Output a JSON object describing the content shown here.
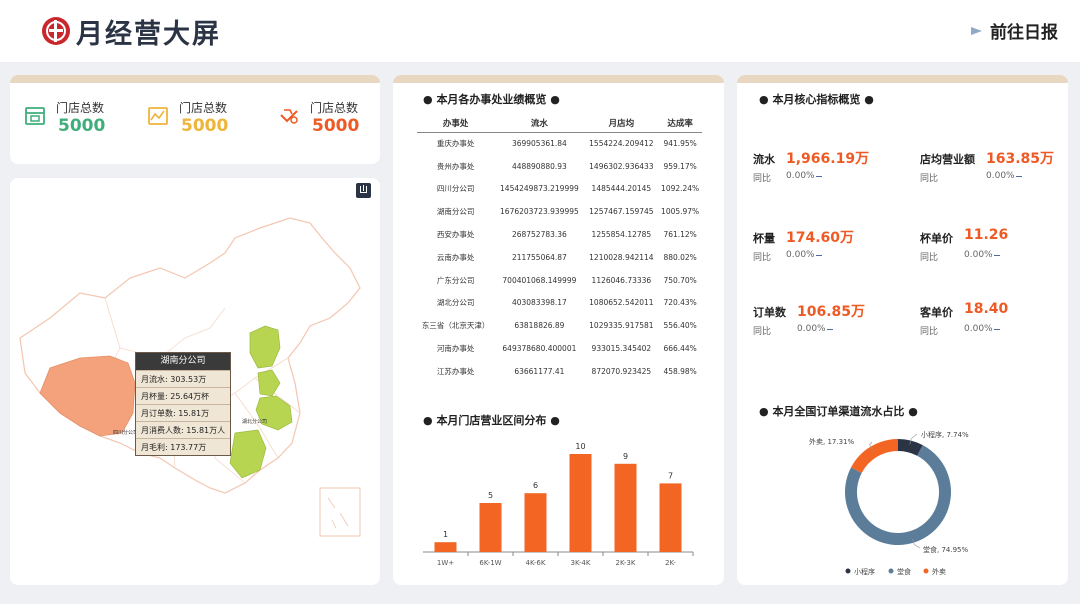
{
  "header": {
    "title": "月经营大屏",
    "goto_label": "前往日报"
  },
  "store_totals": [
    {
      "label": "门店总数",
      "value": "5000",
      "color": "#3fae7a",
      "icon": "store-icon"
    },
    {
      "label": "门店总数",
      "value": "5000",
      "color": "#efb43a",
      "icon": "chart-icon"
    },
    {
      "label": "门店总数",
      "value": "5000",
      "color": "#ef5a24",
      "icon": "hand-icon"
    }
  ],
  "map": {
    "tooltip": {
      "title": "湖南分公司",
      "rows": [
        "月流水: 303.53万",
        "月杯量: 25.64万杯",
        "月订单数: 15.81万",
        "月消费人数: 15.81万人",
        "月毛利: 173.77万"
      ]
    },
    "labels": {
      "sichuan": "四川分公司",
      "hubei": "湖北分公司"
    },
    "colors": {
      "highlight": "#f3a27c",
      "green": "#b8d552",
      "base": "#ffffff",
      "border": "#f3c6b0"
    }
  },
  "office_section": {
    "title": "本月各办事处业绩概览",
    "headers": [
      "办事处",
      "流水",
      "月店均",
      "达成率"
    ],
    "rows": [
      [
        "重庆办事处",
        "369905361.84",
        "1554224.209412",
        "941.95%"
      ],
      [
        "贵州办事处",
        "448890880.93",
        "1496302.936433",
        "959.17%"
      ],
      [
        "四川分公司",
        "1454249873.219999",
        "1485444.20145",
        "1092.24%"
      ],
      [
        "湖南分公司",
        "1676203723.939995",
        "1257467.159745",
        "1005.97%"
      ],
      [
        "西安办事处",
        "268752783.36",
        "1255854.12785",
        "761.12%"
      ],
      [
        "云南办事处",
        "211755064.87",
        "1210028.942114",
        "880.02%"
      ],
      [
        "广东分公司",
        "700401068.149999",
        "1126046.73336",
        "750.70%"
      ],
      [
        "湖北分公司",
        "403083398.17",
        "1080652.542011",
        "720.43%"
      ],
      [
        "东三省（北京天津）",
        "63818826.89",
        "1029335.917581",
        "556.40%"
      ],
      [
        "河南办事处",
        "649378680.400001",
        "933015.345402",
        "666.44%"
      ],
      [
        "江苏办事处",
        "63661177.41",
        "872070.923425",
        "458.98%"
      ]
    ]
  },
  "range_section": {
    "title": "本月门店营业区间分布"
  },
  "kpi_section": {
    "title": "本月核心指标概览",
    "items": [
      {
        "name": "流水",
        "value": "1,966.19万",
        "yoy_label": "同比",
        "yoy": "0.00%"
      },
      {
        "name": "店均营业额",
        "value": "163.85万",
        "yoy_label": "同比",
        "yoy": "0.00%"
      },
      {
        "name": "杯量",
        "value": "174.60万",
        "yoy_label": "同比",
        "yoy": "0.00%"
      },
      {
        "name": "杯单价",
        "value": "11.26",
        "yoy_label": "同比",
        "yoy": "0.00%"
      },
      {
        "name": "订单数",
        "value": "106.85万",
        "yoy_label": "同比",
        "yoy": "0.00%"
      },
      {
        "name": "客单价",
        "value": "18.40",
        "yoy_label": "同比",
        "yoy": "0.00%"
      }
    ]
  },
  "channel_section": {
    "title": "本月全国订单渠道流水占比"
  },
  "chart_data": [
    {
      "type": "bar",
      "title": "本月门店营业区间分布",
      "categories": [
        "1W+",
        "6K-1W",
        "4K-6K",
        "3K-4K",
        "2K-3K",
        "2K-"
      ],
      "values": [
        1,
        5,
        6,
        10,
        9,
        7
      ],
      "ylim": [
        0,
        10
      ],
      "color": "#f26522"
    },
    {
      "type": "pie",
      "title": "本月全国订单渠道流水占比",
      "labels": [
        "小程序",
        "堂食",
        "外卖"
      ],
      "values": [
        7.74,
        74.95,
        17.31
      ],
      "slice_labels": [
        "小程序, 7.74%",
        "堂食, 74.95%",
        "外卖, 17.31%"
      ],
      "colors": [
        "#2b3445",
        "#5b7d99",
        "#f26522"
      ],
      "legend": "bottom"
    }
  ]
}
